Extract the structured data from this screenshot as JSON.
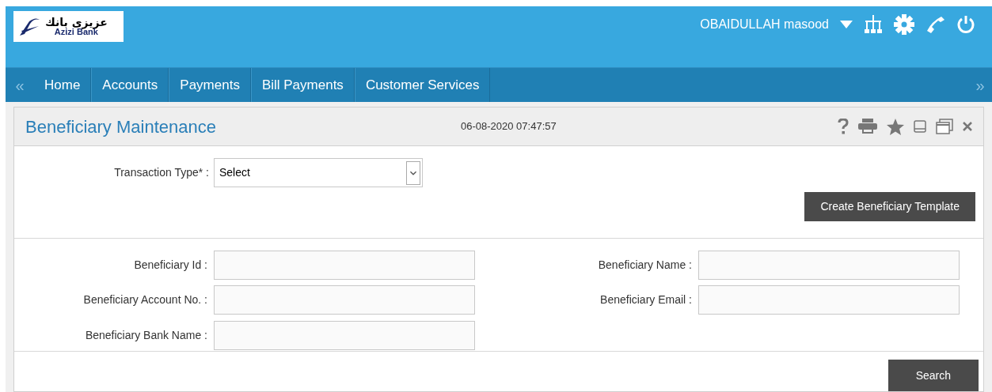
{
  "header": {
    "logo": {
      "native_name": "عزيزى بانك",
      "name": "Azizi Bank"
    },
    "user": "OBAIDULLAH masood"
  },
  "nav": {
    "prev": "«",
    "next": "»",
    "items": [
      "Home",
      "Accounts",
      "Payments",
      "Bill Payments",
      "Customer Services"
    ]
  },
  "panel": {
    "title": "Beneficiary Maintenance",
    "timestamp": "06-08-2020 07:47:57",
    "transaction_type": {
      "label": "Transaction Type* :",
      "value": "Select"
    },
    "create_button": "Create Beneficiary Template",
    "field_rows": [
      [
        {
          "label": "Beneficiary Id :"
        },
        {
          "label": "Beneficiary Name :"
        }
      ],
      [
        {
          "label": "Beneficiary Account No. :"
        },
        {
          "label": "Beneficiary Email :"
        }
      ],
      [
        {
          "label": "Beneficiary Bank Name :"
        }
      ]
    ],
    "search_button": "Search"
  }
}
